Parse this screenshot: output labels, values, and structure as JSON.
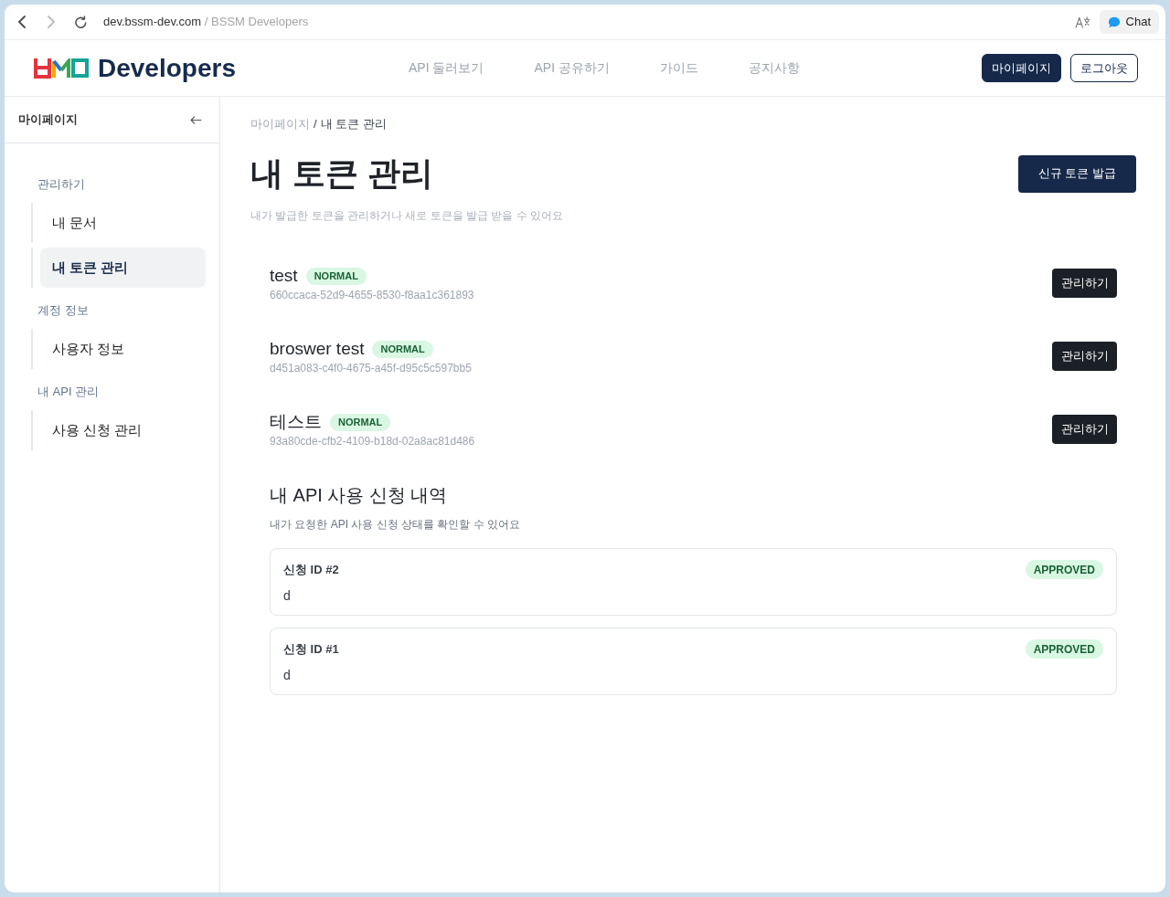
{
  "browser": {
    "nav_buttons": [
      {
        "kind": "back",
        "disabled": false
      },
      {
        "kind": "forward",
        "disabled": true
      },
      {
        "kind": "reload",
        "disabled": false
      }
    ],
    "url": "dev.bssm-dev.com",
    "title_separator": "/",
    "page_title": "BSSM Developers",
    "chat_button": "Chat"
  },
  "header": {
    "logo_text": "Developers",
    "nav": [
      "API 둘러보기",
      "API 공유하기",
      "가이드",
      "공지사항"
    ],
    "buttons": [
      {
        "label": "마이페이지",
        "kind": "primary"
      },
      {
        "label": "로그아웃",
        "kind": "outline"
      }
    ]
  },
  "sidebar": {
    "title": "마이페이지",
    "groups": [
      {
        "label": "관리하기",
        "items": [
          {
            "label": "내 문서",
            "selected": false
          },
          {
            "label": "내 토큰 관리",
            "selected": true
          }
        ]
      },
      {
        "label": "계정 정보",
        "items": [
          {
            "label": "사용자 정보",
            "selected": false
          }
        ]
      },
      {
        "label": "내 API 관리",
        "items": [
          {
            "label": "사용 신청 관리",
            "selected": false
          }
        ]
      }
    ]
  },
  "main": {
    "breadcrumb": {
      "parent": "마이페이지",
      "separator": "/",
      "current": "내 토큰 관리"
    },
    "title": "내 토큰 관리",
    "subtitle": "내가 발급한 토큰을 관리하거나 새로 토큰을 발급 받을 수 있어요",
    "new_token_button": "신규 토큰 발급",
    "tokens": [
      {
        "name": "test",
        "status": "NORMAL",
        "id": "660ccaca-52d9-4655-8530-f8aa1c361893",
        "button": "관리하기"
      },
      {
        "name": "broswer test",
        "status": "NORMAL",
        "id": "d451a083-c4f0-4675-a45f-d95c5c597bb5",
        "button": "관리하기"
      },
      {
        "name": "테스트",
        "status": "NORMAL",
        "id": "93a80cde-cfb2-4109-b18d-02a8ac81d486",
        "button": "관리하기"
      }
    ],
    "requests_section": {
      "title": "내 API 사용 신청 내역",
      "subtitle": "내가 요청한 API 사용 신청 상태를 확인할 수 있어요",
      "requests": [
        {
          "title": "신청 ID #2",
          "status": "APPROVED",
          "body": "d"
        },
        {
          "title": "신청 ID #1",
          "status": "APPROVED",
          "body": "d"
        }
      ]
    }
  }
}
